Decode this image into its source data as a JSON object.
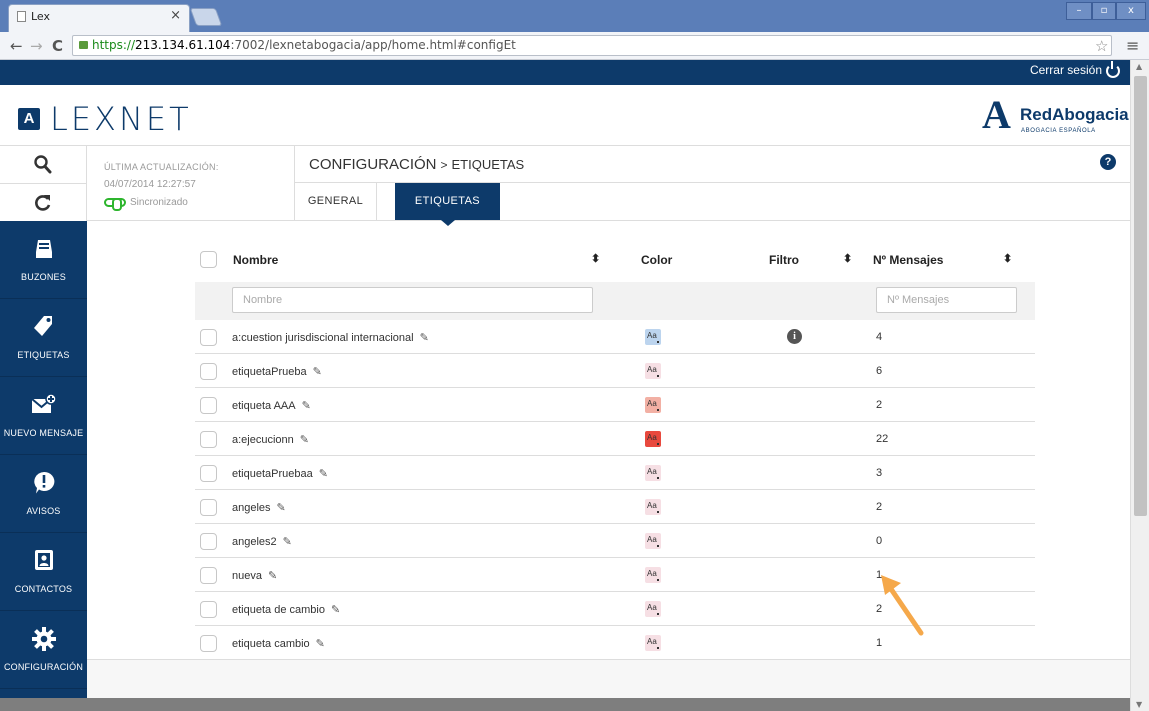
{
  "browser": {
    "tab_title": "Lex",
    "tab_close": "×",
    "url_scheme": "https://",
    "url_host": "213.134.61.104",
    "url_rest": ":7002/lexnetabogacia/app/home.html#configEt"
  },
  "appbar": {
    "logout_label": "Cerrar sesión"
  },
  "header": {
    "lexnet_badge": "A",
    "lexnet_word": "LEXNET",
    "partner_mark": "A",
    "partner_name": "RedAbogacia",
    "partner_sub": "ABOGACIA ESPAÑOLA"
  },
  "status": {
    "update_label": "ÚLTIMA ACTUALIZACIÓN:",
    "update_date": "04/07/2014 12:27:57",
    "sync_label": "Sincronizado"
  },
  "breadcrumb": {
    "section": "CONFIGURACIÓN",
    "separator": ">",
    "current": "ETIQUETAS"
  },
  "tabs": [
    {
      "label": "GENERAL",
      "active": false
    },
    {
      "label": "ETIQUETAS",
      "active": true
    }
  ],
  "sidebar": {
    "items": [
      {
        "label": "BUZONES",
        "icon": "inbox-icon"
      },
      {
        "label": "ETIQUETAS",
        "icon": "tag-icon"
      },
      {
        "label": "NUEVO MENSAJE",
        "icon": "new-message-icon"
      },
      {
        "label": "AVISOS",
        "icon": "alert-icon"
      },
      {
        "label": "CONTACTOS",
        "icon": "contacts-icon"
      },
      {
        "label": "CONFIGURACIÓN",
        "icon": "gear-icon"
      }
    ]
  },
  "table": {
    "columns": {
      "nombre": "Nombre",
      "color": "Color",
      "filtro": "Filtro",
      "mensajes": "Nº Mensajes"
    },
    "filters": {
      "nombre_placeholder": "Nombre",
      "mensajes_placeholder": "Nº Mensajes"
    },
    "swatch_text": "Aa",
    "info_text": "i",
    "rows": [
      {
        "name": "a:cuestion jurisdiscional internacional",
        "count": "4",
        "swatch": "#bcd4ee",
        "has_filter": true
      },
      {
        "name": "etiquetaPrueba",
        "count": "6",
        "swatch": "#f6dfe4",
        "has_filter": false
      },
      {
        "name": "etiqueta AAA",
        "count": "2",
        "swatch": "#f2b0a4",
        "has_filter": false
      },
      {
        "name": "a:ejecucionn",
        "count": "22",
        "swatch": "#e8493e",
        "has_filter": false
      },
      {
        "name": "etiquetaPruebaa",
        "count": "3",
        "swatch": "#f6dfe4",
        "has_filter": false
      },
      {
        "name": "angeles",
        "count": "2",
        "swatch": "#f6dfe4",
        "has_filter": false
      },
      {
        "name": "angeles2",
        "count": "0",
        "swatch": "#f6dfe4",
        "has_filter": false
      },
      {
        "name": "nueva",
        "count": "1",
        "swatch": "#f6dfe4",
        "has_filter": false
      },
      {
        "name": "etiqueta de cambio",
        "count": "2",
        "swatch": "#f6dfe4",
        "has_filter": false
      },
      {
        "name": "etiqueta cambio",
        "count": "1",
        "swatch": "#f6dfe4",
        "has_filter": false
      }
    ]
  },
  "colors": {
    "brand": "#0d3a6a",
    "sync": "#2db52d",
    "annotation_arrow": "#f5a84a"
  }
}
